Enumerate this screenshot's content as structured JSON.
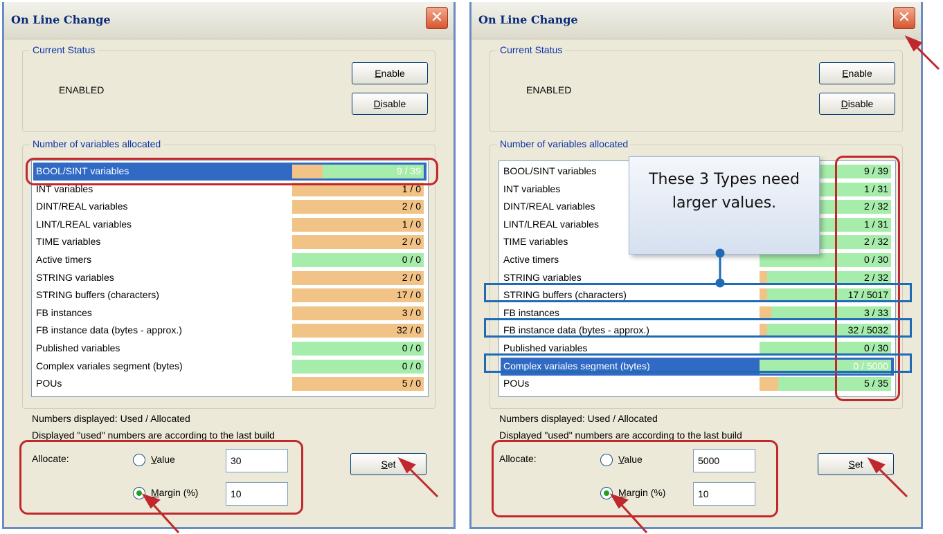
{
  "dialog": {
    "title": "On Line Change",
    "close_glyph": "✕",
    "status_legend": "Current Status",
    "status_value": "ENABLED",
    "enable_pre": "",
    "enable_u": "E",
    "enable_post": "nable",
    "disable_u": "D",
    "disable_post": "isable",
    "vars_legend": "Number of variables allocated",
    "info_line1": "Numbers displayed: Used / Allocated",
    "info_line2": "Displayed \"used\" numbers are according to the last build",
    "allocate_label": "Allocate:",
    "value_u": "V",
    "value_post": "alue",
    "margin_u": "M",
    "margin_post": "argin (%)",
    "set_u": "S",
    "set_post": "et"
  },
  "left": {
    "value_field": "30",
    "margin_field": "10",
    "selected_radio": "margin",
    "rows": [
      {
        "label": "BOOL/SINT variables",
        "value": "9 / 39",
        "used_frac": 0.23,
        "status": "ok",
        "selected": true
      },
      {
        "label": "INT variables",
        "value": "1 / 0",
        "used_frac": 1,
        "status": "over",
        "selected": false
      },
      {
        "label": "DINT/REAL variables",
        "value": "2 / 0",
        "used_frac": 1,
        "status": "over",
        "selected": false
      },
      {
        "label": "LINT/LREAL variables",
        "value": "1 / 0",
        "used_frac": 1,
        "status": "over",
        "selected": false
      },
      {
        "label": "TIME variables",
        "value": "2 / 0",
        "used_frac": 1,
        "status": "over",
        "selected": false
      },
      {
        "label": "Active timers",
        "value": "0 / 0",
        "used_frac": 0,
        "status": "ok",
        "selected": false
      },
      {
        "label": "STRING variables",
        "value": "2 / 0",
        "used_frac": 1,
        "status": "over",
        "selected": false
      },
      {
        "label": "STRING buffers (characters)",
        "value": "17 / 0",
        "used_frac": 1,
        "status": "over",
        "selected": false
      },
      {
        "label": "FB instances",
        "value": "3 / 0",
        "used_frac": 1,
        "status": "over",
        "selected": false
      },
      {
        "label": "FB instance data (bytes - approx.)",
        "value": "32 / 0",
        "used_frac": 1,
        "status": "over",
        "selected": false
      },
      {
        "label": "Published variables",
        "value": "0 / 0",
        "used_frac": 0,
        "status": "ok",
        "selected": false
      },
      {
        "label": "Complex variales segment (bytes)",
        "value": "0 / 0",
        "used_frac": 0,
        "status": "ok",
        "selected": false
      },
      {
        "label": "POUs",
        "value": "5 / 0",
        "used_frac": 1,
        "status": "over",
        "selected": false
      }
    ]
  },
  "right": {
    "value_field": "5000",
    "margin_field": "10",
    "selected_radio": "margin",
    "callout_text": "These 3 Types need larger values.",
    "rows": [
      {
        "label": "BOOL/SINT variables",
        "value": "9 / 39",
        "used_frac": 0.23,
        "status": "ok",
        "selected": false
      },
      {
        "label": "INT variables",
        "value": "1 / 31",
        "used_frac": 0.03,
        "status": "ok",
        "selected": false
      },
      {
        "label": "DINT/REAL variables",
        "value": "2 / 32",
        "used_frac": 0.06,
        "status": "ok",
        "selected": false
      },
      {
        "label": "LINT/LREAL variables",
        "value": "1 / 31",
        "used_frac": 0.03,
        "status": "ok",
        "selected": false
      },
      {
        "label": "TIME variables",
        "value": "2 / 32",
        "used_frac": 0.06,
        "status": "ok",
        "selected": false
      },
      {
        "label": "Active timers",
        "value": "0 / 30",
        "used_frac": 0,
        "status": "ok",
        "selected": false
      },
      {
        "label": "STRING variables",
        "value": "2 / 32",
        "used_frac": 0.06,
        "status": "ok",
        "selected": false
      },
      {
        "label": "STRING buffers (characters)",
        "value": "17 / 5017",
        "used_frac": 0.003,
        "status": "ok",
        "selected": false
      },
      {
        "label": "FB instances",
        "value": "3 / 33",
        "used_frac": 0.09,
        "status": "ok",
        "selected": false
      },
      {
        "label": "FB instance data (bytes - approx.)",
        "value": "32 / 5032",
        "used_frac": 0.006,
        "status": "ok",
        "selected": false
      },
      {
        "label": "Published variables",
        "value": "0 / 30",
        "used_frac": 0,
        "status": "ok",
        "selected": false
      },
      {
        "label": "Complex variales segment (bytes)",
        "value": "0 / 5000",
        "used_frac": 0,
        "status": "ok",
        "selected": true
      },
      {
        "label": "POUs",
        "value": "5 / 35",
        "used_frac": 0.14,
        "status": "ok",
        "selected": false
      }
    ]
  },
  "colors": {
    "used_fill": "#f2c386",
    "free_fill": "#a6ecaa",
    "selected_row": "#316ac5",
    "annotation_red": "#c0282d",
    "annotation_blue": "#1f6bb5"
  }
}
